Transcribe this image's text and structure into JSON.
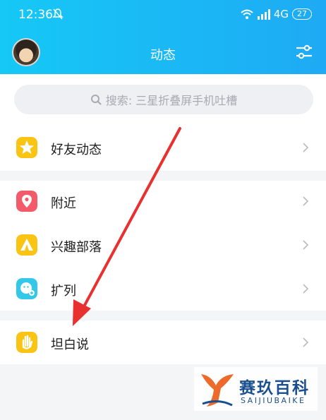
{
  "status": {
    "time": "12:36",
    "network": "4G",
    "battery": "27"
  },
  "header": {
    "title": "动态"
  },
  "search": {
    "placeholder": "搜索: 三星折叠屏手机吐槽"
  },
  "menu": [
    {
      "label": "好友动态",
      "icon": "star-icon",
      "color": "#f9c414"
    },
    {
      "label": "附近",
      "icon": "location-pin-icon",
      "color": "#f35b6b"
    },
    {
      "label": "兴趣部落",
      "icon": "tent-icon",
      "color": "#f9c414"
    },
    {
      "label": "扩列",
      "icon": "smiley-add-icon",
      "color": "#33c8ea"
    },
    {
      "label": "坦白说",
      "icon": "hand-icon",
      "color": "#f9c414"
    }
  ],
  "watermark": {
    "name": "赛玖百科",
    "sub": "SAIJIUBAIKE"
  },
  "colors": {
    "header_start": "#16c8f6",
    "header_end": "#1eaaf4",
    "arrow": "#e8312f"
  }
}
